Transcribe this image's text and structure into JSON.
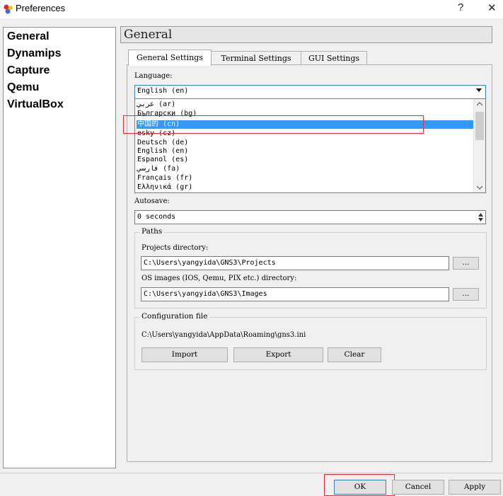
{
  "window": {
    "title": "Preferences",
    "help_glyph": "?",
    "close_glyph": "✕"
  },
  "sidebar": {
    "items": [
      {
        "label": "General"
      },
      {
        "label": "Dynamips"
      },
      {
        "label": "Capture"
      },
      {
        "label": "Qemu"
      },
      {
        "label": "VirtualBox"
      }
    ]
  },
  "page": {
    "title": "General"
  },
  "tabs": [
    {
      "label": "General Settings",
      "active": true
    },
    {
      "label": "Terminal Settings",
      "active": false
    },
    {
      "label": "GUI Settings",
      "active": false
    }
  ],
  "language": {
    "label": "Language:",
    "selected": "English (en)",
    "options": [
      {
        "label": "عربي (ar)",
        "selected": false
      },
      {
        "label": "Български (bg)",
        "selected": false
      },
      {
        "label": "中国的 (cn)",
        "selected": true
      },
      {
        "label": "esky (cz)",
        "selected": false
      },
      {
        "label": "Deutsch (de)",
        "selected": false
      },
      {
        "label": "English (en)",
        "selected": false
      },
      {
        "label": "Espanol (es)",
        "selected": false
      },
      {
        "label": "فارسي (fa)",
        "selected": false
      },
      {
        "label": "Français (fr)",
        "selected": false
      },
      {
        "label": "Ελληνικά (gr)",
        "selected": false
      }
    ]
  },
  "autosave": {
    "label": "Autosave:",
    "value": "0 seconds"
  },
  "paths": {
    "title": "Paths",
    "projects_label": "Projects directory:",
    "projects_value": "C:\\Users\\yangyida\\GNS3\\Projects",
    "images_label": "OS images (IOS, Qemu, PIX etc.) directory:",
    "images_value": "C:\\Users\\yangyida\\GNS3\\Images",
    "browse_label": "..."
  },
  "config": {
    "title": "Configuration file",
    "path": "C:\\Users\\yangyida\\AppData\\Roaming\\gns3.ini",
    "import_label": "Import",
    "export_label": "Export",
    "clear_label": "Clear"
  },
  "footer": {
    "ok_label": "OK",
    "cancel_label": "Cancel",
    "apply_label": "Apply"
  },
  "colors": {
    "selection": "#3399ff",
    "highlight_box": "#e03030",
    "focus_border": "#3c7fb1"
  }
}
